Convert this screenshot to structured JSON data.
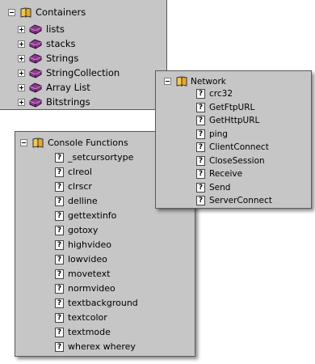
{
  "containers": {
    "title": "Containers",
    "items": [
      "lists",
      "stacks",
      "Strings",
      "StringCollection",
      "Array List",
      "Bitstrings"
    ]
  },
  "network": {
    "title": "Network",
    "items": [
      "crc32",
      "GetFtpURL",
      "GetHttpURL",
      "ping",
      "ClientConnect",
      "CloseSession",
      "Receive",
      "Send",
      "ServerConnect"
    ]
  },
  "console": {
    "title": "Console Functions",
    "items": [
      "_setcursortype",
      "clreol",
      "clrscr",
      "delline",
      "gettextinfo",
      "gotoxy",
      "highvideo",
      "lowvideo",
      "movetext",
      "normvideo",
      "textbackground",
      "textcolor",
      "textmode",
      "wherex wherey"
    ]
  },
  "icons": {
    "expand": "expand-toggle-icon",
    "collapse": "collapse-toggle-icon",
    "folder": "book-folder-icon",
    "container_item": "purple-gem-icon",
    "help_item": "question-mark-icon"
  },
  "colors": {
    "panel_background": "#c6c6c6",
    "gem": "#8a3a8c",
    "book": "#e8b23a"
  }
}
